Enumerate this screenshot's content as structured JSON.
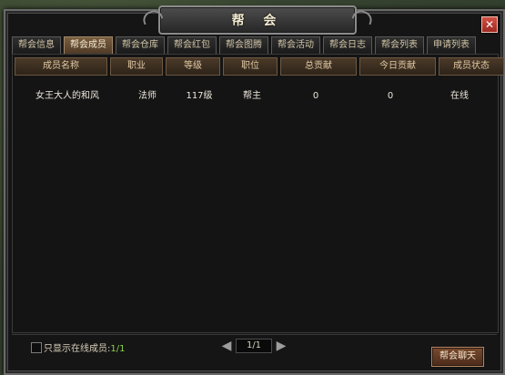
{
  "window": {
    "title": "帮 会",
    "close_glyph": "✕"
  },
  "tabs": [
    {
      "label": "帮会信息"
    },
    {
      "label": "帮会成员",
      "active": true
    },
    {
      "label": "帮会仓库"
    },
    {
      "label": "帮会红包"
    },
    {
      "label": "帮会图腾"
    },
    {
      "label": "帮会活动"
    },
    {
      "label": "帮会日志"
    },
    {
      "label": "帮会列表"
    },
    {
      "label": "申请列表"
    }
  ],
  "table": {
    "headers": [
      "成员名称",
      "职业",
      "等级",
      "职位",
      "总贡献",
      "今日贡献",
      "成员状态"
    ],
    "rows": [
      [
        "女王大人的和风",
        "法师",
        "117级",
        "帮主",
        "0",
        "0",
        "在线"
      ]
    ]
  },
  "footer": {
    "online_only_label": "只显示在线成员:",
    "online_count": "1/1",
    "page_indicator": "1/1",
    "chat_button": "帮会聊天"
  }
}
